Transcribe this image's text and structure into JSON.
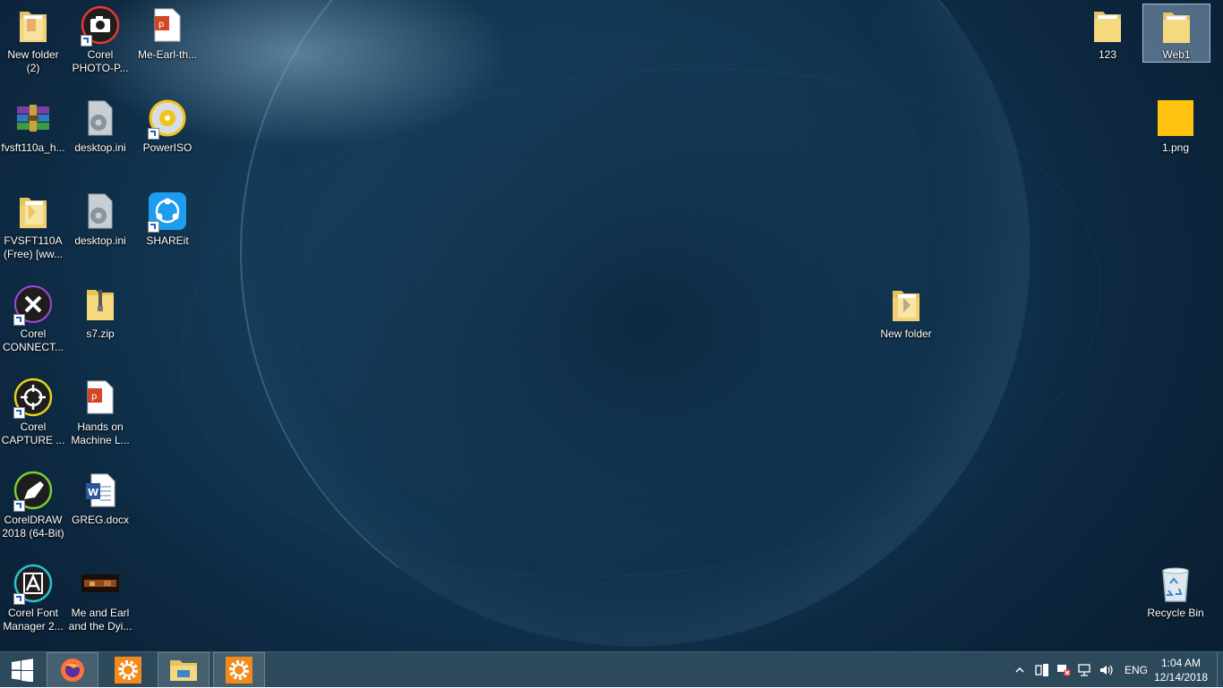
{
  "desktop": {
    "icons": {
      "new_folder_2": "New folder\n(2)",
      "corel_photo": "Corel\nPHOTO-P...",
      "me_earl_th": "Me-Earl-th...",
      "fvsft_rar": "fvsft110a_h...",
      "desktop_ini_1": "desktop.ini",
      "poweriso": "PowerISO",
      "fvsft_folder": "FVSFT110A\n(Free) [ww...",
      "desktop_ini_2": "desktop.ini",
      "shareit": "SHAREit",
      "corel_connect": "Corel\nCONNECT...",
      "s7_zip": "s7.zip",
      "corel_capture": "Corel\nCAPTURE ...",
      "hands_on_ml": "Hands on\nMachine L...",
      "coreldraw": "CorelDRAW\n2018 (64-Bit)",
      "greg_docx": "GREG.docx",
      "corel_font_manager": "Corel Font\nManager 2...",
      "me_and_earl_video": "Me and Earl\nand the Dyi...",
      "new_folder": "New folder",
      "folder_123": "123",
      "web1": "Web1",
      "png_1": "1.png",
      "recycle_bin": "Recycle Bin"
    }
  },
  "taskbar": {
    "language": "ENG",
    "time": "1:04 AM",
    "date": "12/14/2018"
  },
  "colors": {
    "taskbar": "#2d4a5d",
    "folder": "#f2d57a",
    "pdf_red": "#d24726",
    "png_yellow": "#ffc20e",
    "firefox_orange": "#ff7139",
    "settings_orange": "#f28a1d"
  }
}
